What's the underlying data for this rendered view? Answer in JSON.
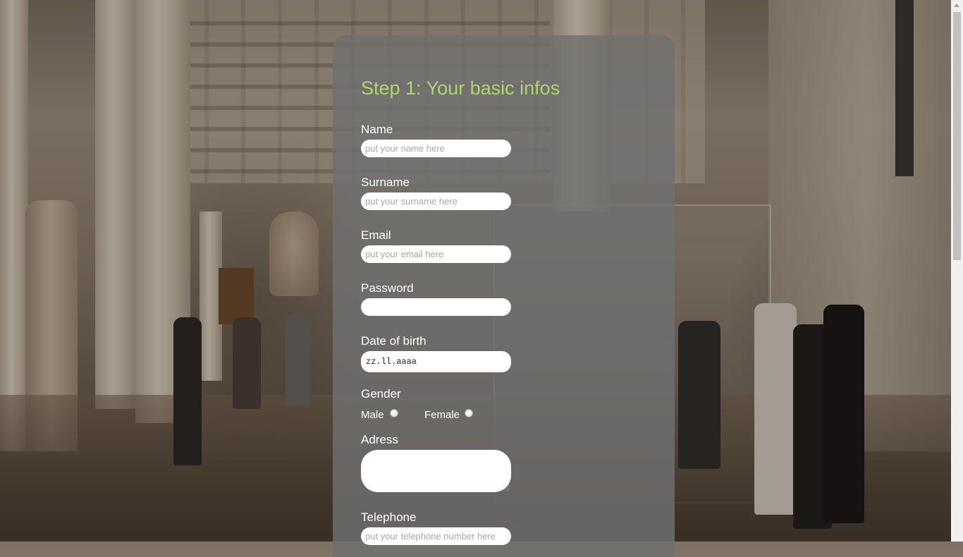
{
  "form": {
    "title": "Step 1: Your basic infos",
    "name": {
      "label": "Name",
      "placeholder": "put your name here"
    },
    "surname": {
      "label": "Surname",
      "placeholder": "put your surname here"
    },
    "email": {
      "label": "Email",
      "placeholder": "put your email here"
    },
    "password": {
      "label": "Password",
      "placeholder": ""
    },
    "dob": {
      "label": "Date of birth",
      "value": "zz.ll.aaaa"
    },
    "gender": {
      "label": "Gender",
      "male": "Male",
      "female": "Female"
    },
    "address": {
      "label": "Adress"
    },
    "telephone": {
      "label": "Telephone",
      "placeholder": "put your telephone number here"
    }
  },
  "icons": {
    "radio": "radio-button-icon",
    "resize": "resize-grip-icon",
    "scroll_up": "chevron-up-icon"
  },
  "colors": {
    "title": "#a9d96a",
    "panel": "rgba(112,112,112,0.82)"
  }
}
